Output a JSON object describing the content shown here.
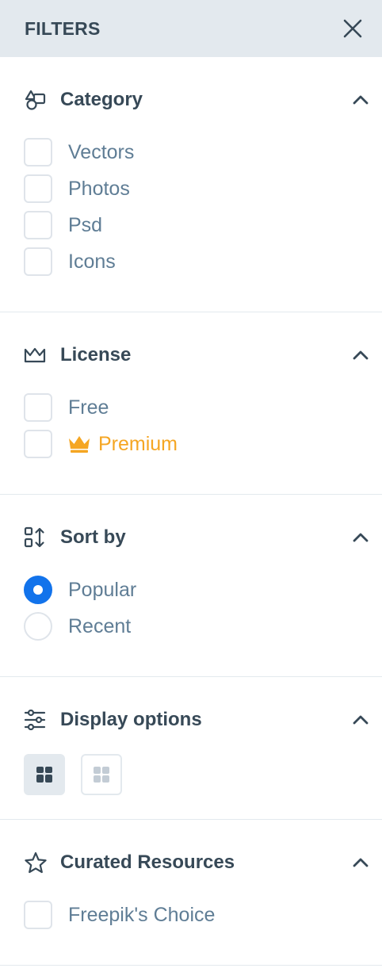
{
  "header": {
    "title": "FILTERS"
  },
  "category": {
    "title": "Category",
    "options": [
      "Vectors",
      "Photos",
      "Psd",
      "Icons"
    ]
  },
  "license": {
    "title": "License",
    "free_label": "Free",
    "premium_label": "Premium"
  },
  "sort": {
    "title": "Sort by",
    "options": [
      "Popular",
      "Recent"
    ],
    "selected": "Popular"
  },
  "display": {
    "title": "Display options",
    "selected_view": "large-grid"
  },
  "curated": {
    "title": "Curated Resources",
    "options": [
      "Freepik's Choice"
    ]
  },
  "colors": {
    "accent": "#1273eb",
    "premium": "#f5a623",
    "header_bg": "#e3e9ee",
    "heading_text": "#374957",
    "option_text": "#5f7d95"
  },
  "icons": {
    "close": "close-icon",
    "category": "shapes-icon",
    "license": "crown-outline-icon",
    "sort": "sort-icon",
    "display": "sliders-icon",
    "curated": "star-icon",
    "chevron": "chevron-up-icon"
  }
}
